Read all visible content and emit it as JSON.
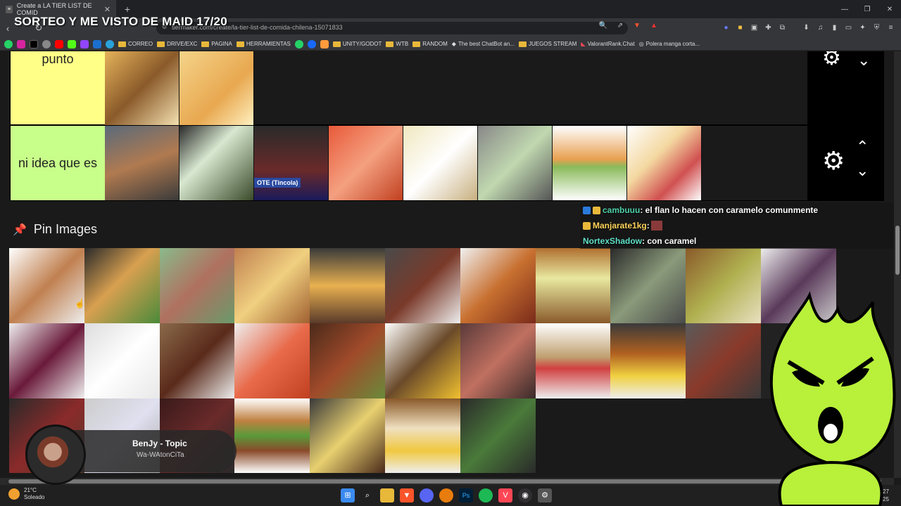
{
  "browser": {
    "tab_title": "Create a LA TIER LIST DE COMID",
    "new_tab": "+",
    "url": "tiermaker.com/create/la-tier-list-de-comida-chilena-15071833",
    "window_controls": [
      "—",
      "❐",
      "✕"
    ]
  },
  "stream_overlay": {
    "title": "SORTEO Y ME VISTO DE MAID 17/20"
  },
  "bookmarks": [
    {
      "label": "CORREO"
    },
    {
      "label": "DRIVE/EXC"
    },
    {
      "label": "PAGINA"
    },
    {
      "label": "HERRAMIENTAS"
    },
    {
      "label": "UNITY/GODOT"
    },
    {
      "label": "WTB"
    },
    {
      "label": "RANDOM"
    },
    {
      "label": "The best ChatBot an..."
    },
    {
      "label": "JUEGOS STREAM"
    },
    {
      "label": "ValorantRank.Chat"
    },
    {
      "label": "Polera manga corta..."
    }
  ],
  "tiers": [
    {
      "label": "punto",
      "color": "#ffff88",
      "images": 2
    },
    {
      "label": "ni idea que es",
      "color": "#c8ff8a",
      "images": 8
    }
  ],
  "tier_image_caption": "OTE (Tincola)",
  "pin_section": {
    "title": "Pin Images"
  },
  "chat": [
    {
      "user": "cambuuu",
      "message": " : el flan lo hacen con caramelo comunmente",
      "user_color": "#4fd1a8"
    },
    {
      "user": "Manjarate1kg",
      "message": " : ",
      "user_color": "#ffd35c"
    },
    {
      "user": "NortexShadow",
      "message": " : con caramel",
      "user_color": "#5fe0c9"
    }
  ],
  "music": {
    "title": "BenJy - Topic",
    "artist": "Wa-WAtonCiTa"
  },
  "taskbar": {
    "temp": "21°C",
    "weather": "Soleado",
    "time": "18:27",
    "date": "27-08-2025"
  },
  "colors": {
    "accent": "#f0a030",
    "tier_punto": "#ffff88",
    "tier_ni_idea": "#c8ff8a"
  }
}
